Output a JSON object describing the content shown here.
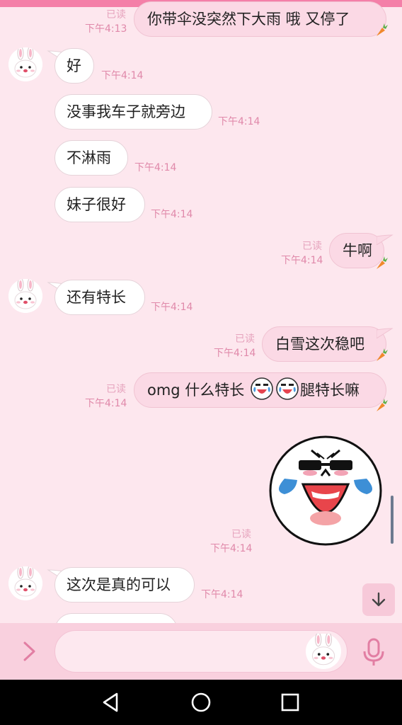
{
  "chat": {
    "messages": [
      {
        "text": "你带伞没突然下大雨 哦 又停了",
        "read": "已读",
        "time": "下午4:13"
      },
      {
        "text": "好",
        "time": "下午4:14"
      },
      {
        "text": "没事我车子就旁边",
        "time": "下午4:14"
      },
      {
        "text": "不淋雨",
        "time": "下午4:14"
      },
      {
        "text": "妹子很好",
        "time": "下午4:14"
      },
      {
        "text": "牛啊",
        "read": "已读",
        "time": "下午4:14"
      },
      {
        "text": "还有特长",
        "time": "下午4:14"
      },
      {
        "text": "白雪这次稳吧",
        "read": "已读",
        "time": "下午4:14"
      },
      {
        "text_before": "omg 什么特长",
        "text_after": "腿特长嘛",
        "read": "已读",
        "time": "下午4:14"
      },
      {
        "sticker": "laughing-crying-face-sticker",
        "read": "已读",
        "time": "下午4:14"
      },
      {
        "text": "这次是真的可以",
        "time": "下午4:14"
      }
    ]
  },
  "input_bar": {
    "placeholder": ""
  },
  "icons": {
    "avatar": "bunny-avatar-icon",
    "read_marker": "carrot-icon",
    "jump": "arrow-down-icon",
    "expand": "chevron-right-icon",
    "sticker": "bunny-sticker-icon",
    "mic": "microphone-icon",
    "nav_back": "triangle-back-icon",
    "nav_home": "circle-home-icon",
    "nav_recent": "square-recent-icon"
  },
  "colors": {
    "background": "#fde7ee",
    "accent": "#f47fa8",
    "bubble_out": "#fbd9e5",
    "bubble_in": "#ffffff",
    "time_text": "#e089aa"
  }
}
